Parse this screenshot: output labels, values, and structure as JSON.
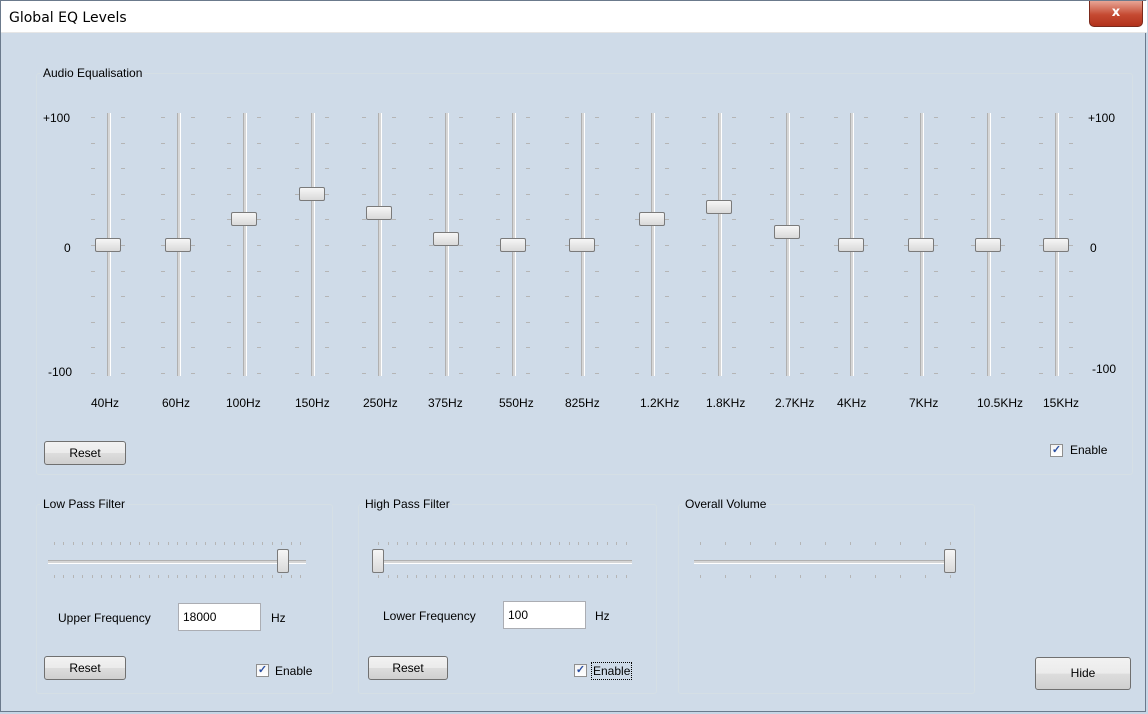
{
  "window": {
    "title": "Global EQ Levels",
    "close_label": "x"
  },
  "eq": {
    "group_label": "Audio Equalisation",
    "scale_top": "+100",
    "scale_mid": "0",
    "scale_bottom": "-100",
    "bands": [
      {
        "label": "40Hz",
        "value": 0
      },
      {
        "label": "60Hz",
        "value": 0
      },
      {
        "label": "100Hz",
        "value": 20
      },
      {
        "label": "150Hz",
        "value": 40
      },
      {
        "label": "250Hz",
        "value": 25
      },
      {
        "label": "375Hz",
        "value": 5
      },
      {
        "label": "550Hz",
        "value": 0
      },
      {
        "label": "825Hz",
        "value": 0
      },
      {
        "label": "1.2KHz",
        "value": 20
      },
      {
        "label": "1.8KHz",
        "value": 30
      },
      {
        "label": "2.7KHz",
        "value": 10
      },
      {
        "label": "4KHz",
        "value": 0
      },
      {
        "label": "7KHz",
        "value": 0
      },
      {
        "label": "10.5KHz",
        "value": 0
      },
      {
        "label": "15KHz",
        "value": 0
      }
    ],
    "reset_label": "Reset",
    "enable_label": "Enable",
    "enabled": true
  },
  "low_pass": {
    "group_label": "Low Pass Filter",
    "freq_label": "Upper Frequency",
    "freq_value": "18000",
    "unit": "Hz",
    "reset_label": "Reset",
    "enable_label": "Enable",
    "enabled": true,
    "slider_level": 0.93
  },
  "high_pass": {
    "group_label": "High Pass Filter",
    "freq_label": "Lower Frequency",
    "freq_value": "100",
    "unit": "Hz",
    "reset_label": "Reset",
    "enable_label": "Enable",
    "enabled": true,
    "slider_level": 0.0
  },
  "volume": {
    "group_label": "Overall Volume",
    "slider_level": 1.0
  },
  "hide_label": "Hide"
}
